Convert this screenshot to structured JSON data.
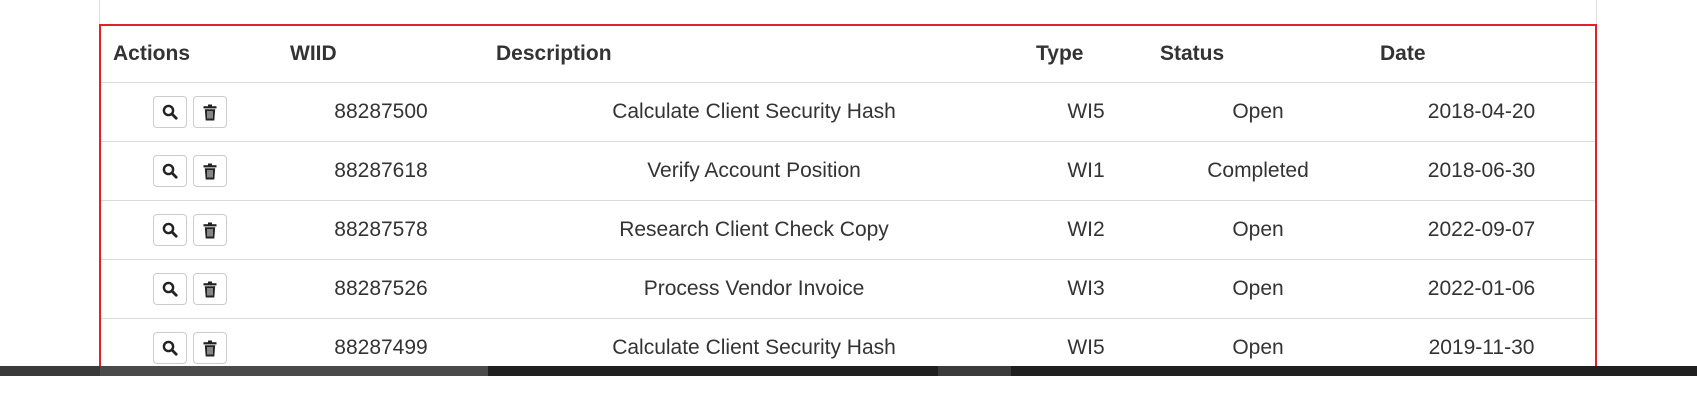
{
  "table": {
    "headers": [
      "Actions",
      "WIID",
      "Description",
      "Type",
      "Status",
      "Date"
    ],
    "rows": [
      {
        "wiid": "88287500",
        "description": "Calculate Client Security Hash",
        "type": "WI5",
        "status": "Open",
        "date": "2018-04-20"
      },
      {
        "wiid": "88287618",
        "description": "Verify Account Position",
        "type": "WI1",
        "status": "Completed",
        "date": "2018-06-30"
      },
      {
        "wiid": "88287578",
        "description": "Research Client Check Copy",
        "type": "WI2",
        "status": "Open",
        "date": "2022-09-07"
      },
      {
        "wiid": "88287526",
        "description": "Process Vendor Invoice",
        "type": "WI3",
        "status": "Open",
        "date": "2022-01-06"
      },
      {
        "wiid": "88287499",
        "description": "Calculate Client Security Hash",
        "type": "WI5",
        "status": "Open",
        "date": "2019-11-30"
      }
    ]
  },
  "icons": {
    "view": "search-icon",
    "delete": "trash-icon"
  },
  "colors": {
    "highlight_border": "#e3202a",
    "taskbar": "#1f1f1f"
  }
}
